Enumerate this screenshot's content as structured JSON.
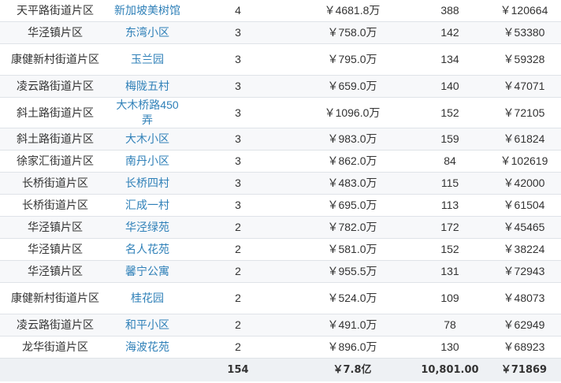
{
  "table": {
    "rows": [
      {
        "district": "天平路街道片区",
        "name": "新加坡美树馆",
        "count": "4",
        "total_price": "￥4681.8万",
        "area": "388",
        "unit_price": "￥120664"
      },
      {
        "district": "华泾镇片区",
        "name": "东湾小区",
        "count": "3",
        "total_price": "￥758.0万",
        "area": "142",
        "unit_price": "￥53380"
      },
      {
        "district": "康健新村街道片区",
        "name": "玉兰园",
        "count": "3",
        "total_price": "￥795.0万",
        "area": "134",
        "unit_price": "￥59328"
      },
      {
        "district": "凌云路街道片区",
        "name": "梅陇五村",
        "count": "3",
        "total_price": "￥659.0万",
        "area": "140",
        "unit_price": "￥47071"
      },
      {
        "district": "斜土路街道片区",
        "name": "大木桥路450弄",
        "count": "3",
        "total_price": "￥1096.0万",
        "area": "152",
        "unit_price": "￥72105"
      },
      {
        "district": "斜土路街道片区",
        "name": "大木小区",
        "count": "3",
        "total_price": "￥983.0万",
        "area": "159",
        "unit_price": "￥61824"
      },
      {
        "district": "徐家汇街道片区",
        "name": "南丹小区",
        "count": "3",
        "total_price": "￥862.0万",
        "area": "84",
        "unit_price": "￥102619"
      },
      {
        "district": "长桥街道片区",
        "name": "长桥四村",
        "count": "3",
        "total_price": "￥483.0万",
        "area": "115",
        "unit_price": "￥42000"
      },
      {
        "district": "长桥街道片区",
        "name": "汇成一村",
        "count": "3",
        "total_price": "￥695.0万",
        "area": "113",
        "unit_price": "￥61504"
      },
      {
        "district": "华泾镇片区",
        "name": "华泾绿苑",
        "count": "2",
        "total_price": "￥782.0万",
        "area": "172",
        "unit_price": "￥45465"
      },
      {
        "district": "华泾镇片区",
        "name": "名人花苑",
        "count": "2",
        "total_price": "￥581.0万",
        "area": "152",
        "unit_price": "￥38224"
      },
      {
        "district": "华泾镇片区",
        "name": "馨宁公寓",
        "count": "2",
        "total_price": "￥955.5万",
        "area": "131",
        "unit_price": "￥72943"
      },
      {
        "district": "康健新村街道片区",
        "name": "桂花园",
        "count": "2",
        "total_price": "￥524.0万",
        "area": "109",
        "unit_price": "￥48073"
      },
      {
        "district": "凌云路街道片区",
        "name": "和平小区",
        "count": "2",
        "total_price": "￥491.0万",
        "area": "78",
        "unit_price": "￥62949"
      },
      {
        "district": "龙华街道片区",
        "name": "海波花苑",
        "count": "2",
        "total_price": "￥896.0万",
        "area": "130",
        "unit_price": "￥68923"
      }
    ],
    "total": {
      "district": "",
      "name": "",
      "count": "154",
      "total_price": "￥7.8亿",
      "area": "10,801.00",
      "unit_price": "￥71869"
    }
  }
}
